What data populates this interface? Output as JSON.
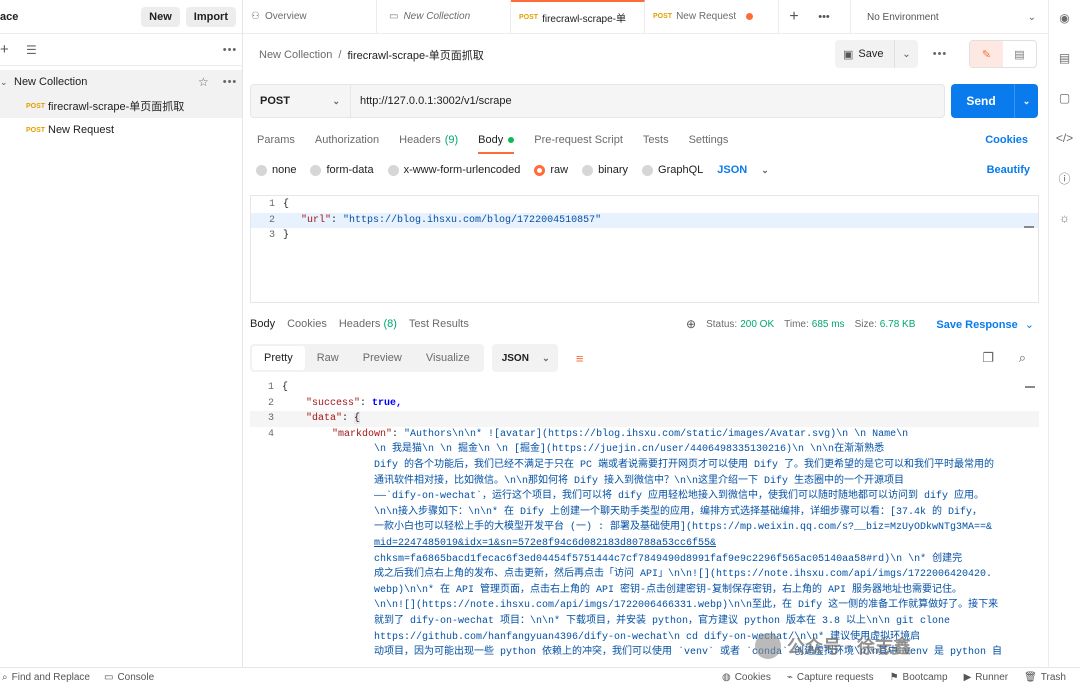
{
  "sidebar": {
    "workspace": "ace",
    "new_label": "New",
    "import_label": "Import",
    "collection_name": "New Collection",
    "requests": [
      {
        "method": "POST",
        "name": "firecrawl-scrape-单页面抓取"
      },
      {
        "method": "POST",
        "name": "New Request"
      }
    ]
  },
  "tabs": [
    {
      "icon": "overview-icon",
      "label": "Overview"
    },
    {
      "icon": "collection-icon",
      "label": "New Collection"
    },
    {
      "method": "POST",
      "label": "firecrawl-scrape-单"
    },
    {
      "method": "POST",
      "label": "New Request"
    }
  ],
  "environment": "No Environment",
  "breadcrumb": {
    "collection": "New Collection",
    "separator": "/",
    "request": "firecrawl-scrape-单页面抓取"
  },
  "save_label": "Save",
  "request": {
    "method": "POST",
    "url": "http://127.0.0.1:3002/v1/scrape",
    "send_label": "Send"
  },
  "request_tabs": {
    "params": "Params",
    "authorization": "Authorization",
    "headers": "Headers",
    "headers_count": "(9)",
    "body": "Body",
    "prerequest": "Pre-request Script",
    "tests": "Tests",
    "settings": "Settings",
    "cookies": "Cookies"
  },
  "body_types": {
    "none": "none",
    "form_data": "form-data",
    "urlencoded": "x-www-form-urlencoded",
    "raw": "raw",
    "binary": "binary",
    "graphql": "GraphQL",
    "format": "JSON",
    "beautify": "Beautify"
  },
  "request_body": {
    "lines": [
      "1",
      "2",
      "3"
    ],
    "open": "{",
    "key": "\"url\"",
    "colon": ": ",
    "value": "\"https://blog.ihsxu.com/blog/1722004510857\"",
    "close": "}"
  },
  "response_tabs": {
    "body": "Body",
    "cookies": "Cookies",
    "headers": "Headers",
    "headers_count": "(8)",
    "tests": "Test Results"
  },
  "response_meta": {
    "status_label": "Status:",
    "status": "200 OK",
    "time_label": "Time:",
    "time": "685 ms",
    "size_label": "Size:",
    "size": "6.78 KB",
    "save_response": "Save Response"
  },
  "response_view": {
    "pretty": "Pretty",
    "raw": "Raw",
    "preview": "Preview",
    "visualize": "Visualize",
    "format": "JSON"
  },
  "response_body": {
    "l1": "{",
    "success_key": "\"success\"",
    "success_val": "true,",
    "data_key": "\"data\"",
    "data_open": "{",
    "markdown_key": "\"markdown\"",
    "md_lines": [
      "\"Authors\\n\\n*   ![avatar](https://blog.ihsxu.com/static/images/Avatar.svg)\\n    \\n      Name\\n",
      "\\n    我是猫\\n    \\n      掘金\\n    \\n    [掘金](https://juejin.cn/user/4406498335130216)\\n    \\n\\n在渐渐熟悉",
      "Dify 的各个功能后，我们已经不满足于只在 PC 端或者说需要打开网页才可以使用 Dify 了。我们更希望的是它可以和我们平时最常用的",
      "通讯软件相对接，比如微信。\\n\\n那如何将 Dify 接入到微信中？\\n\\n这里介绍一下 Dify 生态圈中的一个开源项目",
      "——`dify-on-wechat`，运行这个项目，我们可以将 dify 应用轻松地接入到微信中，使我们可以随时随地都可以访问到 dify 应用。",
      "\\n\\n接入步骤如下：\\n\\n*   在 Dify 上创建一个聊天助手类型的应用，编排方式选择基础编排，详细步骤可以看：[37.4k 的 Dify，",
      "一款小白也可以轻松上手的大模型开发平台 (一) : 部署及基础使用](https://mp.weixin.qq.com/s?__biz=MzUyODkwNTg3MA==&",
      "mid=2247485019&idx=1&sn=572e8f94c6d082183d80788a53cc6f55&",
      "chksm=fa6865bacd1fecac6f3ed04454f5751444c7cf7849490d8991faf9e9c2296f565ac05140aa58#rd)\\n    \\n*   创建完",
      "成之后我们点右上角的发布、点击更新，然后再点击「访问 API」\\n\\n![](https://note.ihsxu.com/api/imgs/1722006420420.",
      "webp)\\n\\n*   在 API 管理页面，点击右上角的 API 密钥-点击创建密钥-复制保存密钥，右上角的 API 服务器地址也需要记住。",
      "\\n\\n![](https://note.ihsxu.com/api/imgs/1722006466331.webp)\\n\\n至此，在 Dify 这一侧的准备工作就算做好了。接下来",
      "就到了 dify-on-wechat 项目：\\n\\n*   下载项目，并安装 python，官方建议 python 版本在 3.8 以上\\n\\n    git clone",
      "https://github.com/hanfangyuan4396/dify-on-wechat\\n    cd dify-on-wechat/\\n\\n*   建议使用虚拟环境启",
      "动项目，因为可能出现一些 python 依赖上的冲突，我们可以使用 `venv` 或者 `conda` 创建虚拟环境\\n\\n其中 venv 是 python 自"
    ]
  },
  "watermark": "公众号 · 徐志鑫",
  "statusbar": {
    "find_replace": "Find and Replace",
    "console": "Console",
    "cookies": "Cookies",
    "capture": "Capture requests",
    "bootcamp": "Bootcamp",
    "runner": "Runner",
    "trash": "Trash"
  }
}
